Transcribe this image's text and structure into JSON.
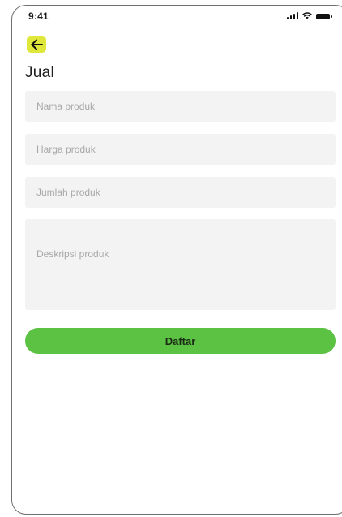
{
  "status_bar": {
    "time": "9:41",
    "icons": [
      "cellular-signal-icon",
      "wifi-icon",
      "battery-icon"
    ]
  },
  "header": {
    "back_icon": "arrow-left-icon",
    "back_color": "#dfe83a",
    "title": "Jual"
  },
  "form": {
    "fields": [
      {
        "placeholder": "Nama produk",
        "value": ""
      },
      {
        "placeholder": "Harga produk",
        "value": ""
      },
      {
        "placeholder": "Jumlah produk",
        "value": ""
      },
      {
        "placeholder": "Deskripsi produk",
        "value": ""
      }
    ],
    "submit_label": "Daftar",
    "submit_color": "#5cc243"
  }
}
